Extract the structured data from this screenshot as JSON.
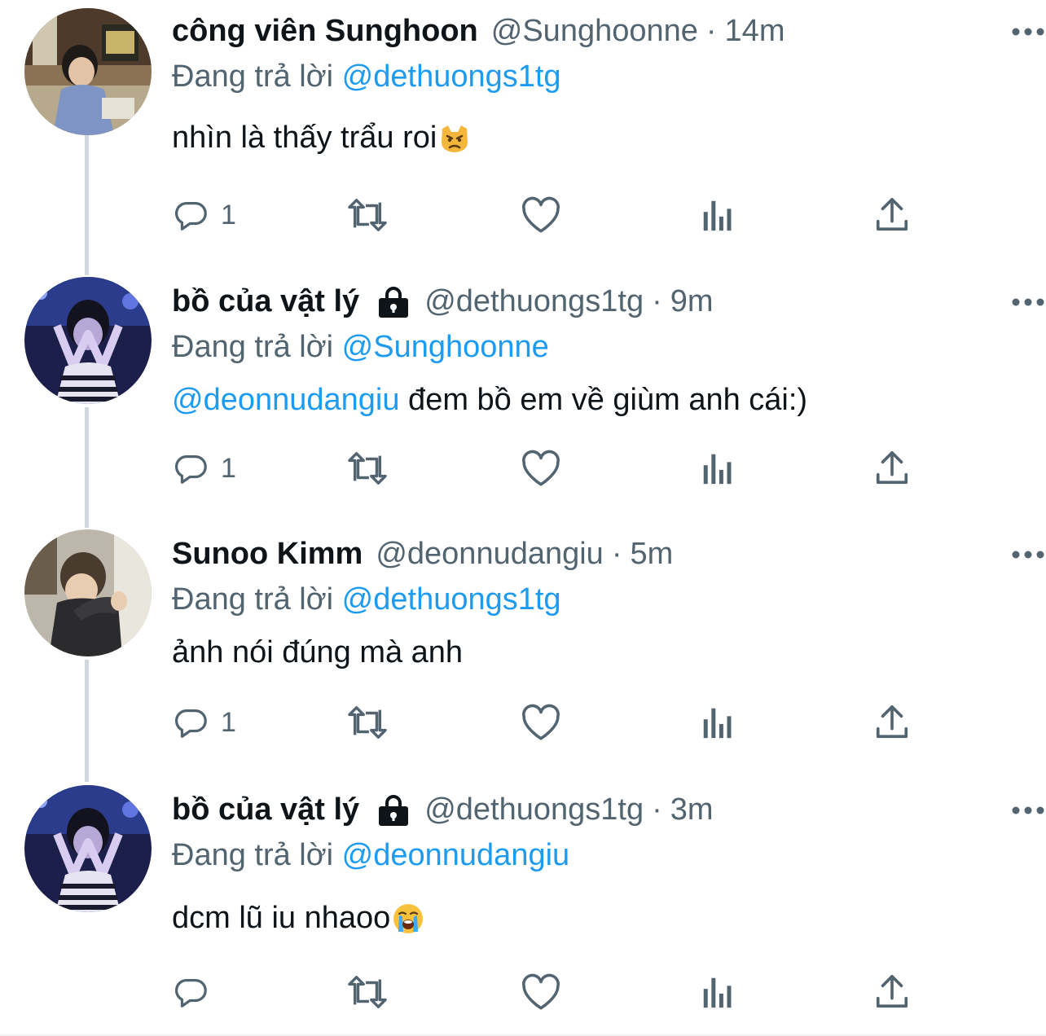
{
  "tweets": [
    {
      "name": "công viên Sunghoon",
      "locked": false,
      "handle": "@Sunghoonne",
      "separator": "·",
      "time": "14m",
      "reply_prefix": "Đang trả lời",
      "reply_to": "@dethuongs1tg",
      "mention": "",
      "text": "nhìn là thấy trẩu roi",
      "emoji": "pouting-cat-emoji",
      "reply_count": "1"
    },
    {
      "name": "bồ của vật lý",
      "locked": true,
      "handle": "@dethuongs1tg",
      "separator": "·",
      "time": "9m",
      "reply_prefix": "Đang trả lời",
      "reply_to": "@Sunghoonne",
      "mention": "@deonnudangiu",
      "text": " đem bồ em về giùm anh cái:)",
      "emoji": "",
      "reply_count": "1"
    },
    {
      "name": "Sunoo Kimm",
      "locked": false,
      "handle": "@deonnudangiu",
      "separator": "·",
      "time": "5m",
      "reply_prefix": "Đang trả lời",
      "reply_to": "@dethuongs1tg",
      "mention": "",
      "text": "ảnh nói đúng mà anh",
      "emoji": "",
      "reply_count": "1"
    },
    {
      "name": "bồ của vật lý",
      "locked": true,
      "handle": "@dethuongs1tg",
      "separator": "·",
      "time": "3m",
      "reply_prefix": "Đang trả lời",
      "reply_to": "@deonnudangiu",
      "mention": "",
      "text": "dcm lũ iu nhaoo",
      "emoji": "loudly-crying-emoji",
      "reply_count": ""
    }
  ],
  "icons": {
    "reply": "reply-icon",
    "retweet": "retweet-icon",
    "like": "heart-icon",
    "views": "views-icon",
    "share": "share-icon",
    "more": "more-icon",
    "lock": "lock-icon"
  },
  "colors": {
    "link": "#1d9bf0",
    "secondary": "#536471",
    "thread_line": "#cfd9de"
  }
}
